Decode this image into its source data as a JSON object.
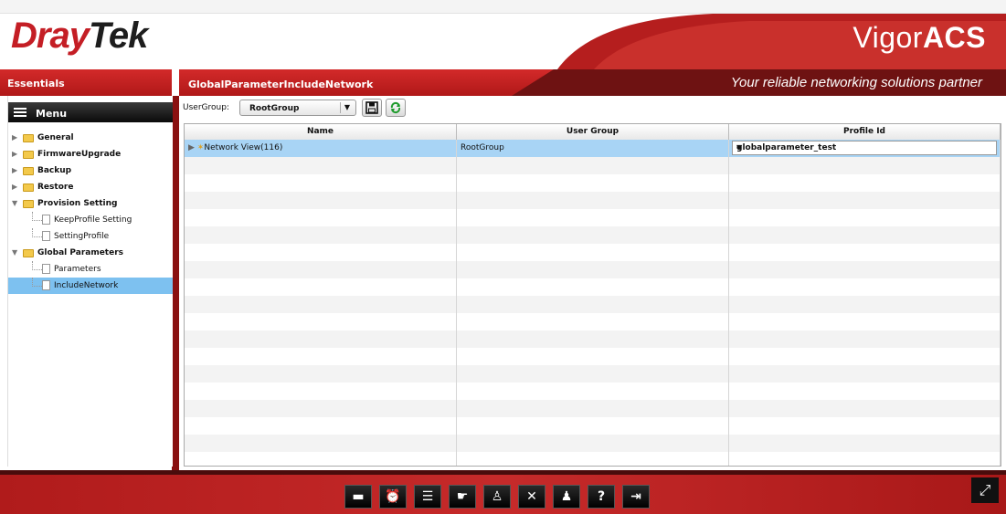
{
  "brand": {
    "logo_part1": "Dray",
    "logo_part2": "Tek",
    "product_prefix": "Vigor",
    "product_suffix": "ACS",
    "tagline": "Your reliable networking solutions partner",
    "accent": "#c41e25"
  },
  "sidebar": {
    "header": "Essentials",
    "menu_label": "Menu",
    "items": [
      {
        "label": "General",
        "type": "folder",
        "expanded": false
      },
      {
        "label": "FirmwareUpgrade",
        "type": "folder",
        "expanded": false
      },
      {
        "label": "Backup",
        "type": "folder",
        "expanded": false
      },
      {
        "label": "Restore",
        "type": "folder",
        "expanded": false
      },
      {
        "label": "Provision Setting",
        "type": "folder",
        "expanded": true
      },
      {
        "label": "KeepProfile Setting",
        "type": "leaf"
      },
      {
        "label": "SettingProfile",
        "type": "leaf"
      },
      {
        "label": "Global Parameters",
        "type": "folder",
        "expanded": true
      },
      {
        "label": "Parameters",
        "type": "leaf"
      },
      {
        "label": "IncludeNetwork",
        "type": "leaf",
        "selected": true
      }
    ]
  },
  "main": {
    "title": "GlobalParameterIncludeNetwork",
    "usergroup_label": "UserGroup:",
    "usergroup_value": "RootGroup",
    "save_icon": "save-icon",
    "refresh_icon": "refresh-icon",
    "columns": [
      "Name",
      "User Group",
      "Profile Id"
    ],
    "rows": [
      {
        "name": "Network View(116)",
        "user_group": "RootGroup",
        "profile_id": "globalparameter_test"
      }
    ]
  },
  "dock": {
    "icons": [
      "router-icon",
      "alarm-clock-icon",
      "list-icon",
      "hand-device-icon",
      "user-icon",
      "tools-icon",
      "users-icon",
      "help-icon",
      "logout-icon"
    ],
    "fullscreen_icon": "fullscreen-icon"
  }
}
